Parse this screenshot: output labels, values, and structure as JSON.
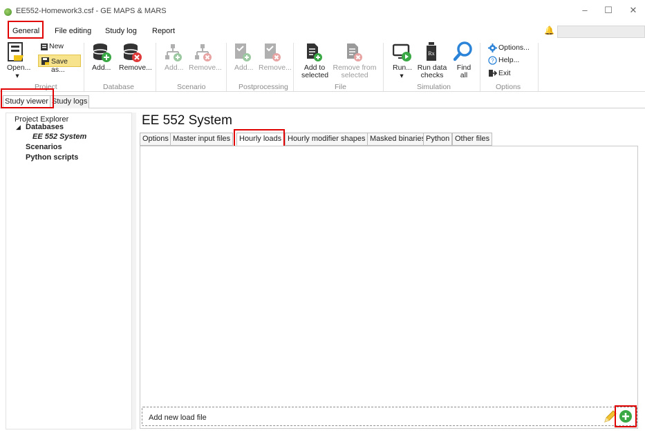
{
  "window": {
    "title": "EE552-Homework3.csf - GE MAPS & MARS",
    "minimize_glyph": "–",
    "maximize_glyph": "☐",
    "close_glyph": "✕"
  },
  "menu_tabs": [
    "General",
    "File editing",
    "Study log",
    "Report"
  ],
  "ribbon": {
    "project": {
      "open": "Open...",
      "new": "New",
      "save_as": "Save as...",
      "group": "Project"
    },
    "database": {
      "add": "Add...",
      "remove": "Remove...",
      "group": "Database"
    },
    "scenario": {
      "add": "Add...",
      "remove": "Remove...",
      "group": "Scenario"
    },
    "postprocessing": {
      "add": "Add...",
      "remove": "Remove...",
      "group": "Postprocessing"
    },
    "file": {
      "add_line1": "Add to",
      "add_line2": "selected",
      "remove_line1": "Remove from",
      "remove_line2": "selected",
      "group": "File"
    },
    "simulation": {
      "run": "Run...",
      "checks_line1": "Run data",
      "checks_line2": "checks",
      "find_line1": "Find",
      "find_line2": "all",
      "group": "Simulation"
    },
    "options": {
      "options": "Options...",
      "help": "Help...",
      "exit": "Exit",
      "group": "Options"
    }
  },
  "study_tabs": [
    "Study viewer",
    "Study logs"
  ],
  "explorer": {
    "heading": "Project Explorer",
    "databases": "Databases",
    "db_item": "EE 552 System",
    "scenarios": "Scenarios",
    "python": "Python scripts"
  },
  "main": {
    "title": "EE 552 System",
    "tabs": [
      "Options",
      "Master input files",
      "Hourly loads",
      "Hourly modifier shapes",
      "Masked binaries",
      "Python",
      "Other files"
    ],
    "active_tab": "Hourly loads",
    "add_row_label": "Add new load file"
  }
}
